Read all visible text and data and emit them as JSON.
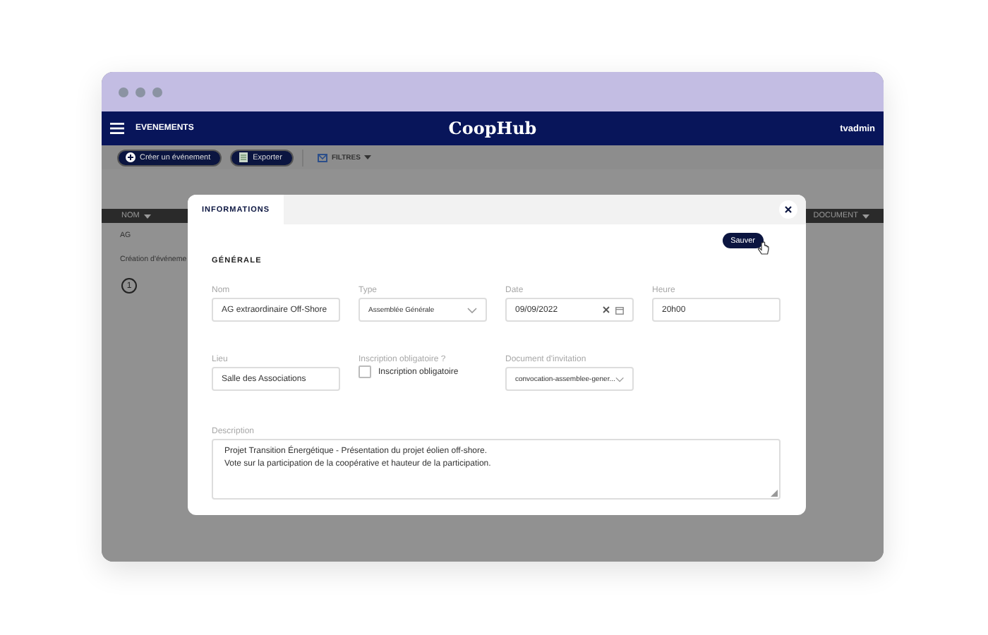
{
  "nav": {
    "section": "EVENEMENTS",
    "logo": "CoopHub",
    "user": "tvadmin"
  },
  "toolbar": {
    "buttons": [
      {
        "label": "Créer un événement",
        "kind": "create"
      },
      {
        "label": "Exporter",
        "kind": "export"
      }
    ],
    "filter": {
      "label": "FILTRES",
      "expanded": false
    }
  },
  "table": {
    "columns": [
      {
        "label": "NOM"
      },
      {
        "label": "DOCUMENT"
      }
    ],
    "rows": [
      {
        "name": "AG"
      },
      {
        "name": "Création d'événeme"
      }
    ],
    "pagination": [
      {
        "label": "1",
        "selected": true
      }
    ]
  },
  "modal": {
    "tabs": [
      {
        "label": "INFORMATIONS",
        "selected": true
      }
    ],
    "save": "Sauver",
    "section": "GÉNÉRALE",
    "fields": [
      {
        "kind": "text",
        "label": "Nom",
        "value": "AG extraordinaire Off-Shore"
      },
      {
        "kind": "select",
        "label": "Type",
        "value": "Assemblée Générale"
      },
      {
        "kind": "date",
        "label": "Date",
        "value": "09/09/2022"
      },
      {
        "kind": "text",
        "label": "Heure",
        "value": "20h00"
      },
      {
        "kind": "text",
        "label": "Lieu",
        "value": "Salle des Associations"
      },
      {
        "kind": "checkbox",
        "label": "Inscription obligatoire ?",
        "text": "Inscription obligatoire",
        "checked": false
      },
      {
        "kind": "select",
        "label": "Document d'invitation",
        "value": "convocation-assemblee-gener..."
      },
      {
        "kind": "textarea",
        "label": "Description",
        "value": "Projet Transition Énergétique - Présentation du projet éolien off-shore.\nVote sur la participation de la coopérative et hauteur de la participation."
      }
    ]
  }
}
